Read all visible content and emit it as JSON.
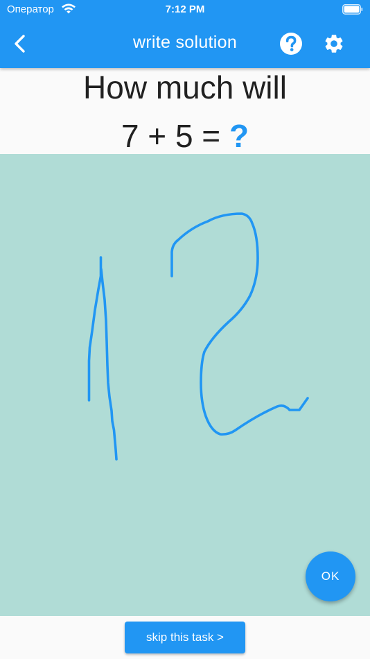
{
  "status_bar": {
    "carrier": "Оператор",
    "time": "7:12 PM"
  },
  "app_bar": {
    "title": "write solution",
    "back_icon": "chevron-left-icon",
    "help_icon": "help-circle-icon",
    "settings_icon": "gear-icon"
  },
  "question": {
    "line1": "How much will",
    "expression": "7 + 5 = ",
    "unknown": "?"
  },
  "canvas": {
    "background": "#b0dcd6",
    "stroke_color": "#2196f3"
  },
  "actions": {
    "ok_label": "OK",
    "skip_label": "skip this task >"
  },
  "colors": {
    "accent": "#2196f3",
    "background": "#fafafa",
    "text": "#212121"
  }
}
